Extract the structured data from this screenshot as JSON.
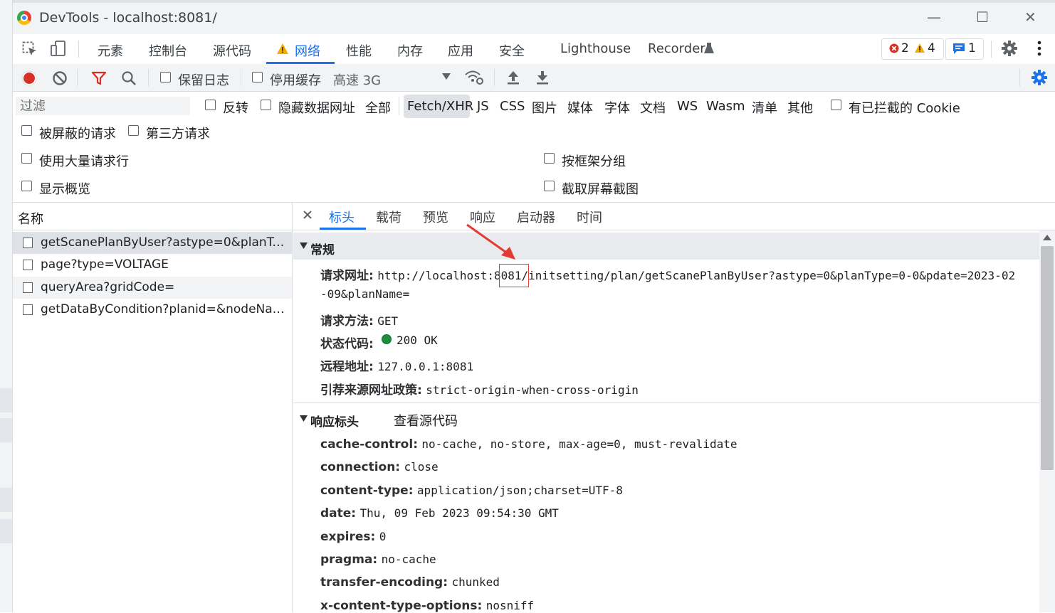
{
  "window": {
    "title": "DevTools - localhost:8081/",
    "minimize": "—",
    "maximize": "☐",
    "close": "✕"
  },
  "main_tabs": [
    "元素",
    "控制台",
    "源代码",
    "网络",
    "性能",
    "内存",
    "应用",
    "安全",
    "Lighthouse",
    "Recorder"
  ],
  "issues": {
    "errors": "2",
    "warnings": "4",
    "messages": "1"
  },
  "toolbar": {
    "preserve_log": "保留日志",
    "disable_cache": "停用缓存",
    "throttle": "高速 3G"
  },
  "filter": {
    "placeholder": "过滤",
    "invert": "反转",
    "hide_data_urls": "隐藏数据网址",
    "types": [
      "全部",
      "Fetch/XHR",
      "JS",
      "CSS",
      "图片",
      "媒体",
      "字体",
      "文档",
      "WS",
      "Wasm",
      "清单",
      "其他"
    ],
    "blocked_cookies": "有已拦截的 Cookie",
    "blocked_requests": "被屏蔽的请求",
    "third_party": "第三方请求"
  },
  "options": {
    "big_rows": "使用大量请求行",
    "group_by_frame": "按框架分组",
    "overview": "显示概览",
    "screenshots": "截取屏幕截图"
  },
  "request_list": {
    "header": "名称",
    "rows": [
      "getScanePlanByUser?astype=0&planType...",
      "page?type=VOLTAGE",
      "queryArea?gridCode=",
      "getDataByCondition?planid=&nodeName..."
    ]
  },
  "detail_tabs": [
    "标头",
    "载荷",
    "预览",
    "响应",
    "启动器",
    "时间"
  ],
  "general": {
    "title": "常规",
    "url_label": "请求网址:",
    "url_prefix": "http://localhost:",
    "url_port": "8081",
    "url_rest": "/initsetting/plan/getScanePlanByUser?astype=0&planType=0-0&pdate=2023-02",
    "url_wrap": "-09&planName=",
    "method_label": "请求方法:",
    "method": "GET",
    "status_label": "状态代码:",
    "status": "200 OK",
    "remote_label": "远程地址:",
    "remote": "127.0.0.1:8081",
    "referrer_label": "引荐来源网址政策:",
    "referrer": "strict-origin-when-cross-origin"
  },
  "response_headers": {
    "title": "响应标头",
    "view_source": "查看源代码",
    "items": [
      {
        "key": "cache-control:",
        "value": "no-cache, no-store, max-age=0, must-revalidate"
      },
      {
        "key": "connection:",
        "value": "close"
      },
      {
        "key": "content-type:",
        "value": "application/json;charset=UTF-8"
      },
      {
        "key": "date:",
        "value": "Thu, 09 Feb 2023 09:54:30 GMT"
      },
      {
        "key": "expires:",
        "value": "0"
      },
      {
        "key": "pragma:",
        "value": "no-cache"
      },
      {
        "key": "transfer-encoding:",
        "value": "chunked"
      },
      {
        "key": "x-content-type-options:",
        "value": "nosniff"
      }
    ]
  },
  "colors": {
    "accent": "#1a73e8",
    "annotation": "#e53935",
    "status_ok": "#1e8e3e"
  }
}
